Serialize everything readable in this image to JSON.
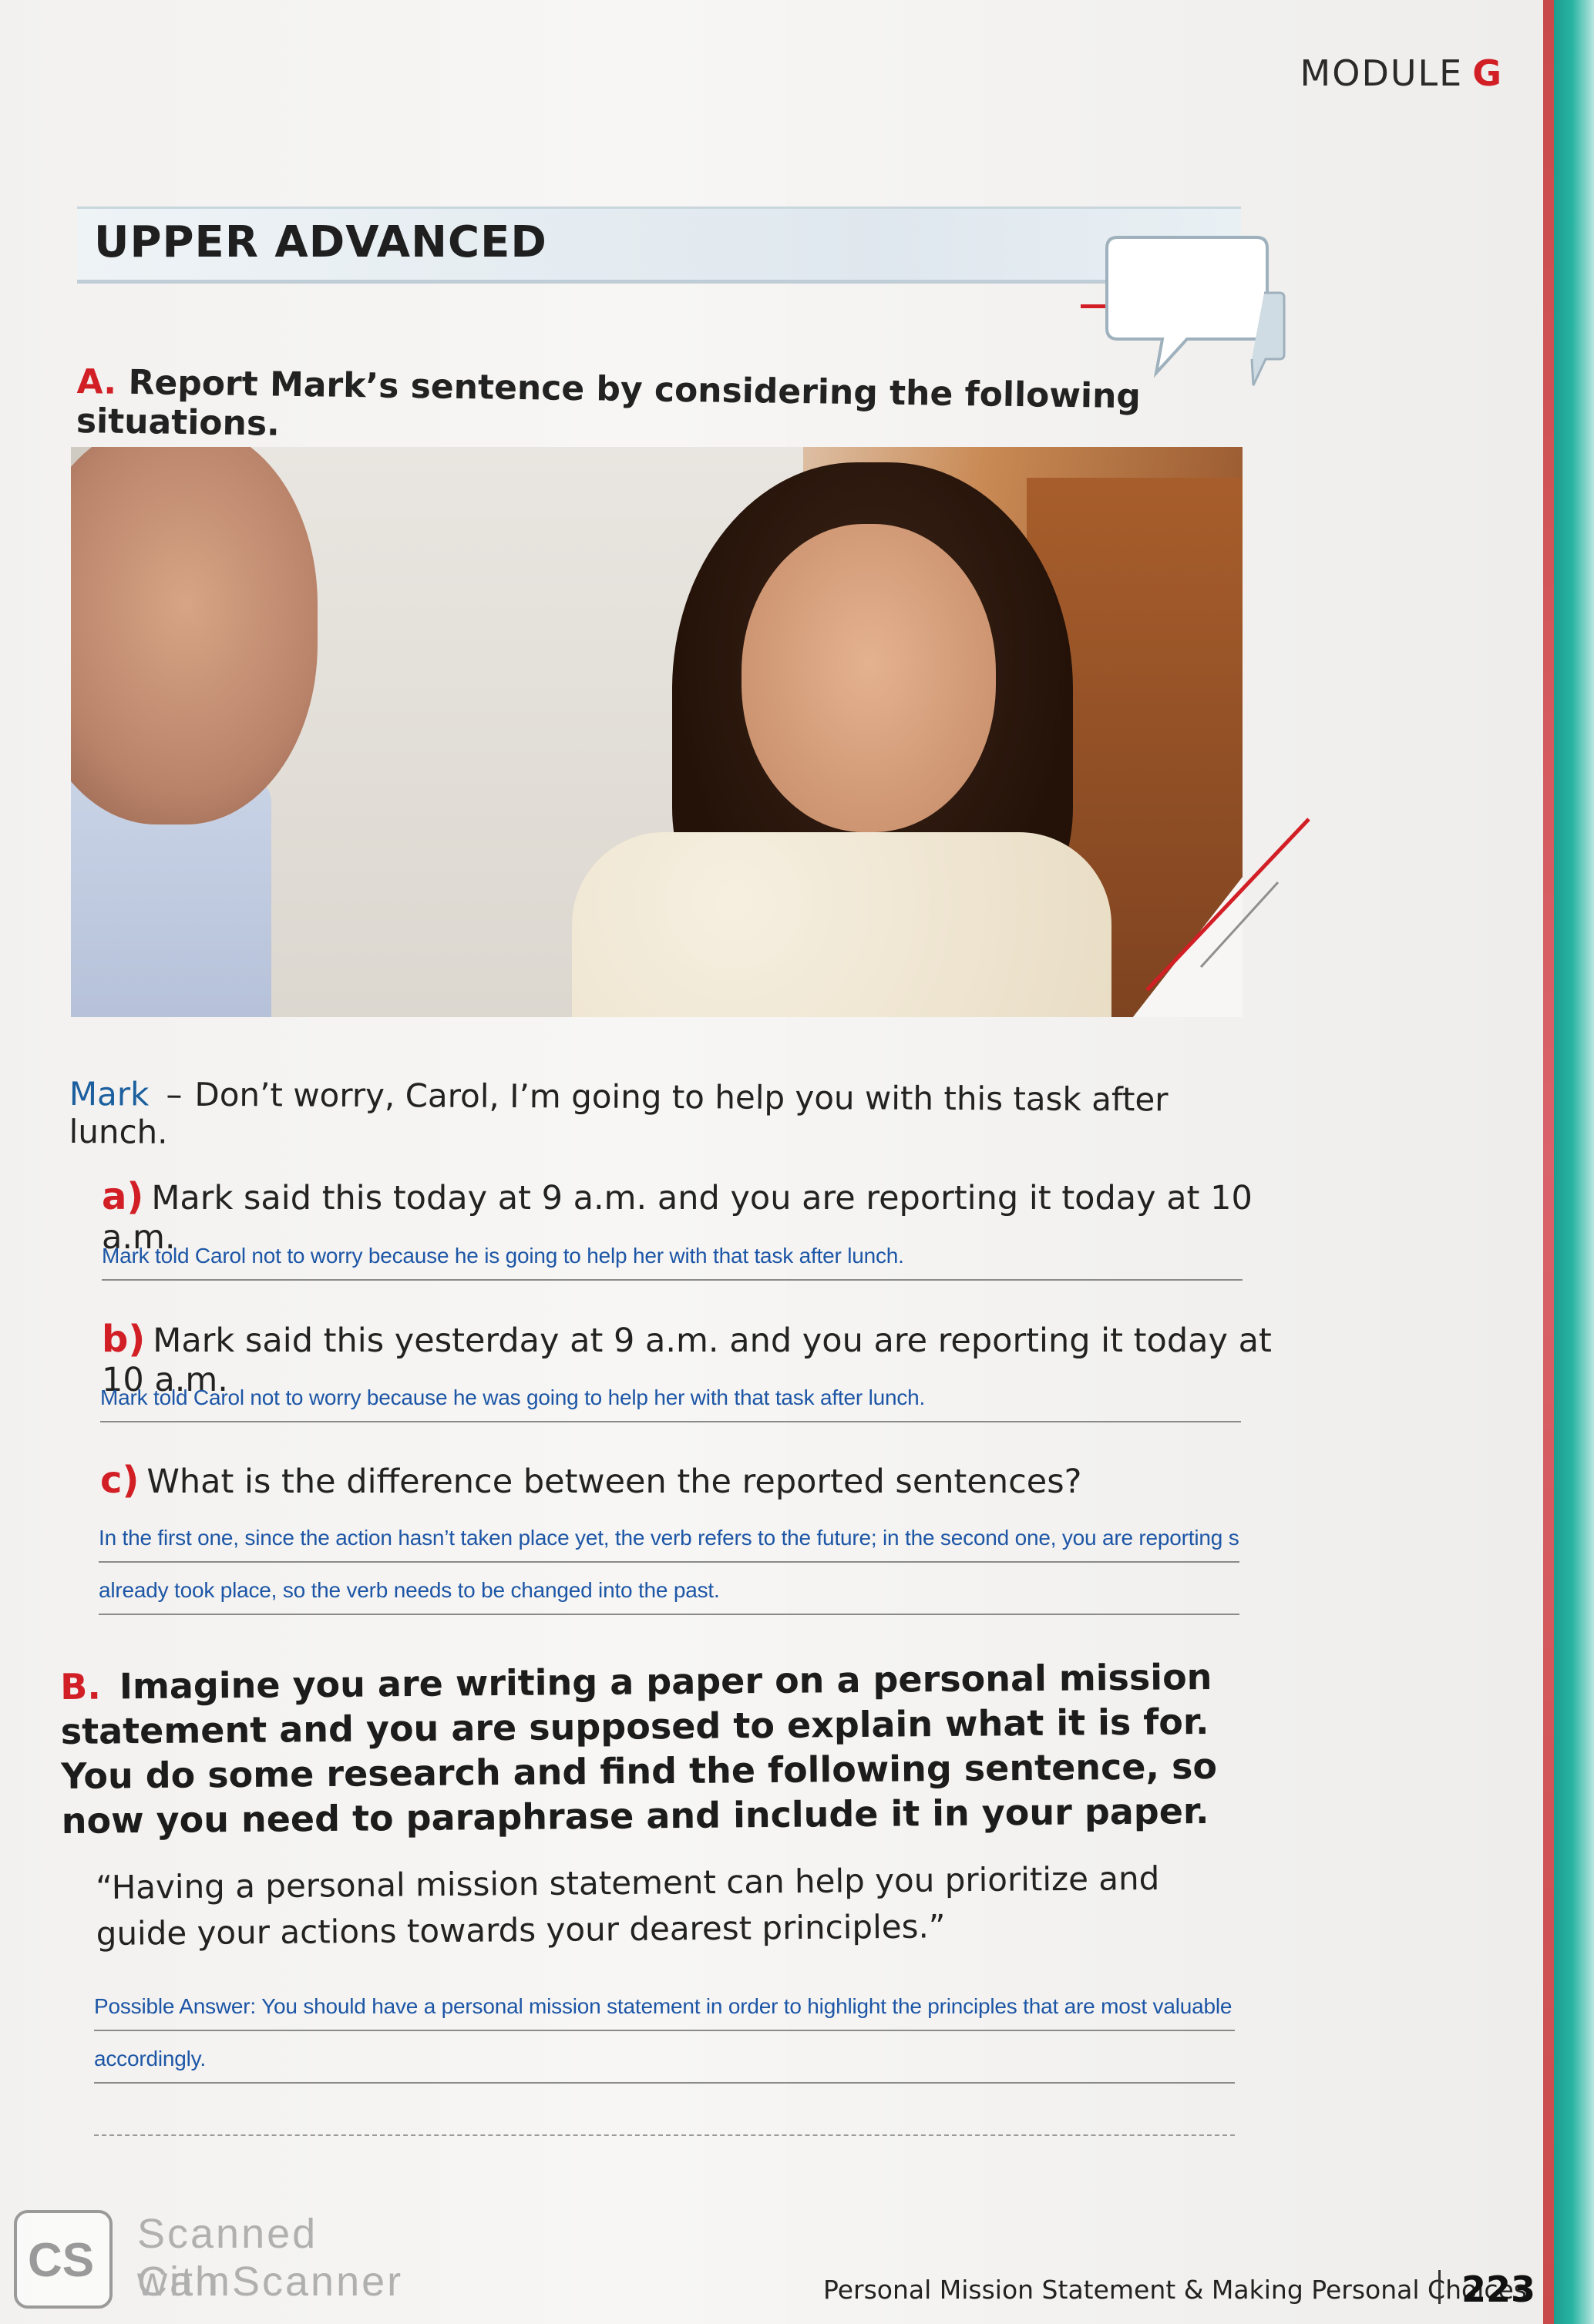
{
  "header": {
    "module_label": "MODULE",
    "module_letter": "G"
  },
  "level": {
    "title": "UPPER ADVANCED"
  },
  "section_a": {
    "letter": "A.",
    "instruction": "Report Mark’s sentence by considering the following situations.",
    "quote": {
      "speaker": "Mark",
      "dash": "–",
      "text": "Don’t worry, Carol, I’m going to help you with this task after lunch."
    },
    "questions": [
      {
        "letter": "a)",
        "text": "Mark said this today at 9 a.m. and you are reporting it today at 10 a.m.",
        "answer": "Mark told Carol not to worry because he is going to help her with that task after lunch."
      },
      {
        "letter": "b)",
        "text": "Mark said this yesterday at 9 a.m. and you are reporting it today at 10 a.m.",
        "answer": "Mark told Carol not to worry because he was going to help her with that task after lunch."
      },
      {
        "letter": "c)",
        "text": "What is the difference between the reported sentences?",
        "answer_line1": "In the first one, since the action hasn’t taken place yet, the verb refers to the future; in the second one, you are reporting something that",
        "answer_line2": "already took place, so the verb needs to be changed into the past."
      }
    ]
  },
  "section_b": {
    "letter": "B.",
    "instruction": "Imagine you are writing a paper on a personal mission statement and you are supposed to explain what it is for. You do some research and find the following sentence, so now you need to paraphrase and include it in your paper.",
    "quote": "“Having a personal mission statement can help you prioritize and guide your actions towards your dearest principles.”",
    "answer_line1": "Possible Answer: You should have a personal mission statement in order to highlight the principles that are most valuable to you and act",
    "answer_line2": "accordingly."
  },
  "footer": {
    "text": "Personal Mission Statement & Making Personal Choices",
    "page_number": "223"
  },
  "watermark": {
    "logo": "CS",
    "line1": "Scanned with",
    "line2": "CamScanner"
  },
  "colors": {
    "accent_red": "#d21f26",
    "answer_blue": "#1d56a6",
    "speaker_blue": "#1c5f9e",
    "edge_teal": "#1e9e8f"
  }
}
